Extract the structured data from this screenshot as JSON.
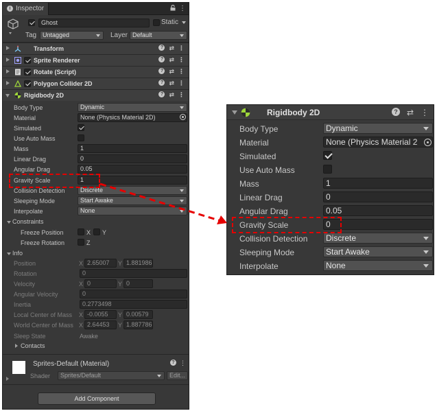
{
  "inspector": {
    "tab_title": "Inspector",
    "object": {
      "name": "Ghost",
      "static_label": "Static",
      "tag_label": "Tag",
      "tag_value": "Untagged",
      "layer_label": "Layer",
      "layer_value": "Default"
    },
    "components": [
      "Transform",
      "Sprite Renderer",
      "Rotate (Script)",
      "Polygon Collider 2D",
      "Rigidbody 2D"
    ],
    "rigidbody": {
      "body_type_label": "Body Type",
      "body_type_value": "Dynamic",
      "material_label": "Material",
      "material_value": "None (Physics Material 2D)",
      "simulated_label": "Simulated",
      "use_auto_mass_label": "Use Auto Mass",
      "mass_label": "Mass",
      "mass_value": "1",
      "linear_drag_label": "Linear Drag",
      "linear_drag_value": "0",
      "angular_drag_label": "Angular Drag",
      "angular_drag_value": "0.05",
      "gravity_scale_label": "Gravity Scale",
      "gravity_scale_value": "1",
      "collision_detection_label": "Collision Detection",
      "collision_detection_value": "Discrete",
      "sleeping_mode_label": "Sleeping Mode",
      "sleeping_mode_value": "Start Awake",
      "interpolate_label": "Interpolate",
      "interpolate_value": "None"
    },
    "constraints": {
      "label": "Constraints",
      "freeze_position": "Freeze Position",
      "freeze_rotation": "Freeze Rotation",
      "x": "X",
      "y": "Y",
      "z": "Z"
    },
    "info": {
      "label": "Info",
      "position_label": "Position",
      "position_x": "2.65007",
      "position_y": "1.881986",
      "rotation_label": "Rotation",
      "rotation_value": "0",
      "velocity_label": "Velocity",
      "velocity_x": "0",
      "velocity_y": "0",
      "angular_velocity_label": "Angular Velocity",
      "angular_velocity_value": "0",
      "inertia_label": "Inertia",
      "inertia_value": "0.2773498",
      "local_com_label": "Local Center of Mass",
      "local_com_x": "-0.0055",
      "local_com_y": "0.00579",
      "world_com_label": "World Center of Mass",
      "world_com_x": "2.64453",
      "world_com_y": "1.887786",
      "sleep_state_label": "Sleep State",
      "sleep_state_value": "Awake",
      "contacts_label": "Contacts"
    },
    "material_section": {
      "title": "Sprites-Default (Material)",
      "shader_label": "Shader",
      "shader_value": "Sprites/Default",
      "edit_label": "Edit..."
    },
    "add_component_label": "Add Component"
  },
  "zoom": {
    "title": "Rigidbody 2D",
    "body_type_label": "Body Type",
    "body_type_value": "Dynamic",
    "material_label": "Material",
    "material_value": "None (Physics Material 2",
    "simulated_label": "Simulated",
    "use_auto_mass_label": "Use Auto Mass",
    "mass_label": "Mass",
    "mass_value": "1",
    "linear_drag_label": "Linear Drag",
    "linear_drag_value": "0",
    "angular_drag_label": "Angular Drag",
    "angular_drag_value": "0.05",
    "gravity_scale_label": "Gravity Scale",
    "gravity_scale_value": "0",
    "collision_detection_label": "Collision Detection",
    "collision_detection_value": "Discrete",
    "sleeping_mode_label": "Sleeping Mode",
    "sleeping_mode_value": "Start Awake",
    "interpolate_label": "Interpolate",
    "interpolate_value": "None"
  },
  "colors": {
    "highlight": "#e60000",
    "panel_bg": "#383838",
    "rigidbody_icon": "#9ed53a"
  },
  "icons": {
    "lock": "lock-icon",
    "menu": "kebab-menu-icon",
    "help": "help-icon",
    "preset": "preset-icon",
    "target": "object-picker-icon"
  }
}
